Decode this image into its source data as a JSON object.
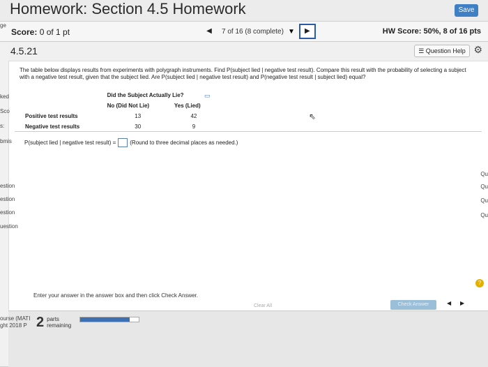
{
  "header": {
    "title": "Homework: Section 4.5 Homework",
    "save_label": "Save"
  },
  "scorebar": {
    "score_label": "Score:",
    "score_value": "0 of 1 pt",
    "nav_prev": "◀",
    "nav_text": "7 of 16 (8 complete)",
    "nav_dropdown": "▼",
    "nav_next": "▶",
    "hw_score": "HW Score: 50%, 8 of 16 pts"
  },
  "question": {
    "number": "4.5.21",
    "help_label": "Question Help",
    "gear": "⚙",
    "text": "The table below displays results from experiments with polygraph instruments. Find P(subject lied | negative test result). Compare this result with the probability of selecting a subject with a negative test result, given that the subject lied. Are P(subject lied | negative test result) and P(negative test result | subject lied) equal?",
    "table": {
      "title": "Did the Subject Actually Lie?",
      "col1": "No (Did Not Lie)",
      "col2": "Yes (Lied)",
      "rows": [
        {
          "label": "Positive test results",
          "no": "13",
          "yes": "42"
        },
        {
          "label": "Negative test results",
          "no": "30",
          "yes": "9"
        }
      ]
    },
    "prompt": "P(subject lied | negative test result) =",
    "hint": "(Round to three decimal places as needed.)"
  },
  "footer": {
    "instructions": "Enter your answer in the answer box and then click Check Answer.",
    "parts_count": "2",
    "parts_label1": "parts",
    "parts_label2": "remaining",
    "progress": 0.85,
    "clear_all": "Clear All",
    "check_answer": "Check Answer",
    "prev": "◀",
    "next": "▶",
    "help": "?"
  },
  "side": {
    "left": [
      "ked",
      "Sco",
      "s:",
      "bmis",
      "estion",
      "estion",
      "estion",
      "uestion",
      "ourse (MATI",
      "ght 2018 P"
    ],
    "right": [
      "Qu",
      "Qu",
      "Qu",
      "Qu"
    ],
    "top": "ge"
  }
}
